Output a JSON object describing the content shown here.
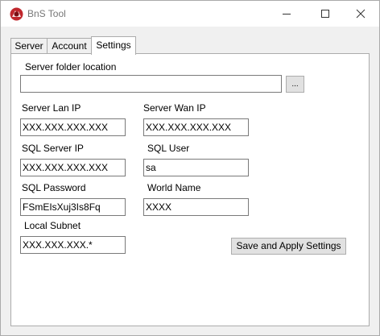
{
  "window": {
    "title": "BnS Tool"
  },
  "tabs": [
    {
      "label": "Server"
    },
    {
      "label": "Account"
    },
    {
      "label": "Settings"
    }
  ],
  "settings": {
    "server_folder_label": "Server folder location",
    "server_folder_value": "",
    "browse_label": "...",
    "server_lan_ip_label": "Server Lan IP",
    "server_lan_ip_value": "XXX.XXX.XXX.XXX",
    "server_wan_ip_label": "Server Wan IP",
    "server_wan_ip_value": "XXX.XXX.XXX.XXX",
    "sql_server_ip_label": "SQL Server IP",
    "sql_server_ip_value": "XXX.XXX.XXX.XXX",
    "sql_user_label": "SQL User",
    "sql_user_value": "sa",
    "sql_password_label": "SQL Password",
    "sql_password_value": "FSmEIsXuj3Is8Fq",
    "world_name_label": "World Name",
    "world_name_value": "XXXX",
    "local_subnet_label": "Local Subnet",
    "local_subnet_value": "XXX.XXX.XXX.*",
    "save_label": "Save and Apply Settings"
  },
  "colors": {
    "app_icon": "#c0272d",
    "border": "#acacac",
    "button_bg": "#e1e1e1"
  }
}
